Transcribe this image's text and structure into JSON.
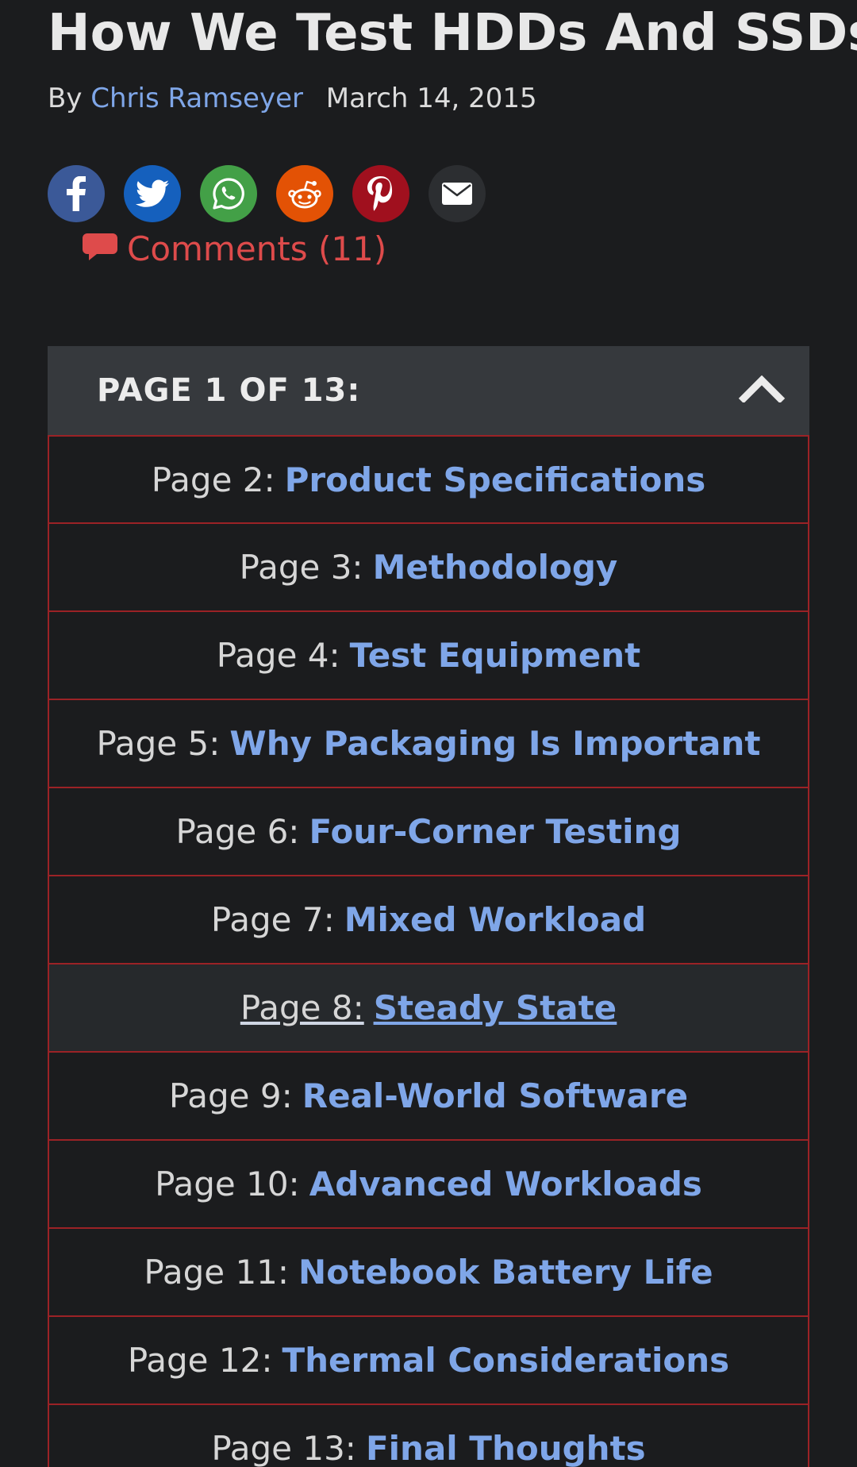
{
  "article": {
    "title": "How We Test HDDs And SSDs",
    "by_label": "By",
    "author": "Chris Ramseyer",
    "date": "March 14, 2015"
  },
  "share": [
    {
      "name": "facebook",
      "icon": "facebook-icon",
      "color": "#3b5998"
    },
    {
      "name": "twitter",
      "icon": "twitter-icon",
      "color": "#1560bd"
    },
    {
      "name": "whatsapp",
      "icon": "whatsapp-icon",
      "color": "#43a047"
    },
    {
      "name": "reddit",
      "icon": "reddit-icon",
      "color": "#e35205"
    },
    {
      "name": "pinterest",
      "icon": "pinterest-icon",
      "color": "#a0101e"
    },
    {
      "name": "email",
      "icon": "email-icon",
      "color": "#2c2e31"
    }
  ],
  "comments": {
    "label": "Comments (11)",
    "icon": "comment-bubble-icon",
    "color": "#de4b4b"
  },
  "toc": {
    "header": "PAGE 1 OF 13:",
    "toggle_icon": "chevron-up-icon",
    "items": [
      {
        "prefix": "Page 2:",
        "title": "Product Specifications"
      },
      {
        "prefix": "Page 3:",
        "title": "Methodology"
      },
      {
        "prefix": "Page 4:",
        "title": "Test Equipment"
      },
      {
        "prefix": "Page 5:",
        "title": "Why Packaging Is Important"
      },
      {
        "prefix": "Page 6:",
        "title": "Four-Corner Testing"
      },
      {
        "prefix": "Page 7:",
        "title": "Mixed Workload"
      },
      {
        "prefix": "Page 8:",
        "title": "Steady State",
        "active": true
      },
      {
        "prefix": "Page 9:",
        "title": "Real-World Software"
      },
      {
        "prefix": "Page 10:",
        "title": "Advanced Workloads"
      },
      {
        "prefix": "Page 11:",
        "title": "Notebook Battery Life"
      },
      {
        "prefix": "Page 12:",
        "title": "Thermal Considerations"
      },
      {
        "prefix": "Page 13:",
        "title": "Final Thoughts"
      }
    ]
  },
  "colors": {
    "background": "#1b1c1e",
    "link": "#7fa6e8",
    "border": "#9b2226",
    "header_bg": "#36393d"
  }
}
